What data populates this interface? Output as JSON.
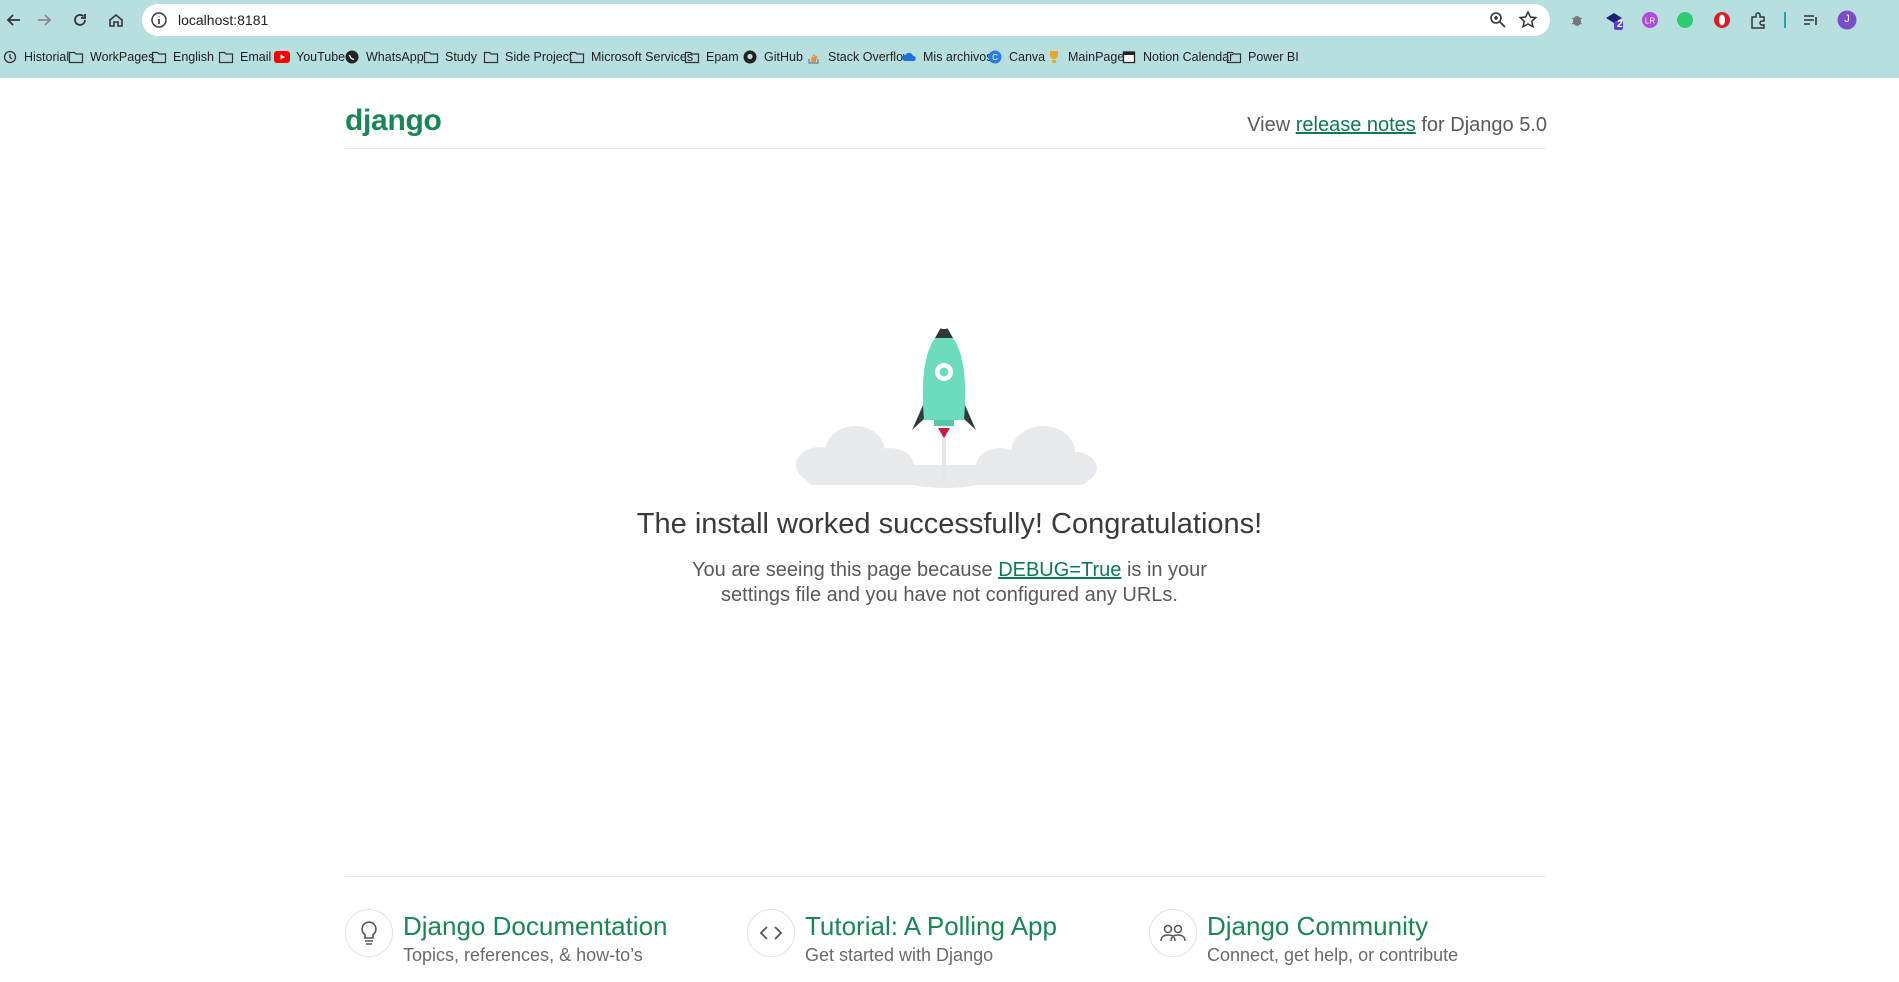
{
  "browser": {
    "url": "localhost:8181",
    "bookmarks": [
      {
        "label": "Historial",
        "icon": "history-icon"
      },
      {
        "label": "WorkPages",
        "icon": "folder-icon"
      },
      {
        "label": "English",
        "icon": "folder-icon"
      },
      {
        "label": "Email",
        "icon": "folder-icon"
      },
      {
        "label": "YouTube",
        "icon": "youtube-icon"
      },
      {
        "label": "WhatsApp",
        "icon": "whatsapp-icon"
      },
      {
        "label": "Study",
        "icon": "folder-icon"
      },
      {
        "label": "Side Project",
        "icon": "folder-icon"
      },
      {
        "label": "Microsoft Services",
        "icon": "folder-icon"
      },
      {
        "label": "Epam",
        "icon": "folder-icon"
      },
      {
        "label": "GitHub",
        "icon": "github-icon"
      },
      {
        "label": "Stack Overflow",
        "icon": "stackoverflow-icon"
      },
      {
        "label": "Mis archivos",
        "icon": "onedrive-icon"
      },
      {
        "label": "Canva",
        "icon": "canva-icon"
      },
      {
        "label": "MainPage",
        "icon": "trophy-icon"
      },
      {
        "label": "Notion Calendar",
        "icon": "calendar-icon"
      },
      {
        "label": "Power BI",
        "icon": "folder-icon"
      }
    ],
    "extension_badge": "2",
    "profile_initial": "J"
  },
  "page": {
    "logo": "django",
    "release_prefix": "View",
    "release_link": "release notes",
    "release_suffix": "for Django 5.0",
    "headline": "The install worked successfully! Congratulations!",
    "desc_prefix": "You are seeing this page because",
    "desc_link": "DEBUG=True",
    "desc_suffix": "is in your",
    "desc_line2": "settings file and you have not configured any URLs."
  },
  "footer": {
    "cards": [
      {
        "title": "Django Documentation",
        "subtitle": "Topics, references, & how-to’s",
        "icon": "lightbulb-icon"
      },
      {
        "title": "Tutorial: A Polling App",
        "subtitle": "Get started with Django",
        "icon": "code-icon"
      },
      {
        "title": "Django Community",
        "subtitle": "Connect, get help, or contribute",
        "icon": "people-icon"
      }
    ]
  },
  "colors": {
    "chrome_bg": "#b8dfe0",
    "django_green": "#198754",
    "link_green": "#0c7a52",
    "rocket_body": "#6ddcbd"
  }
}
